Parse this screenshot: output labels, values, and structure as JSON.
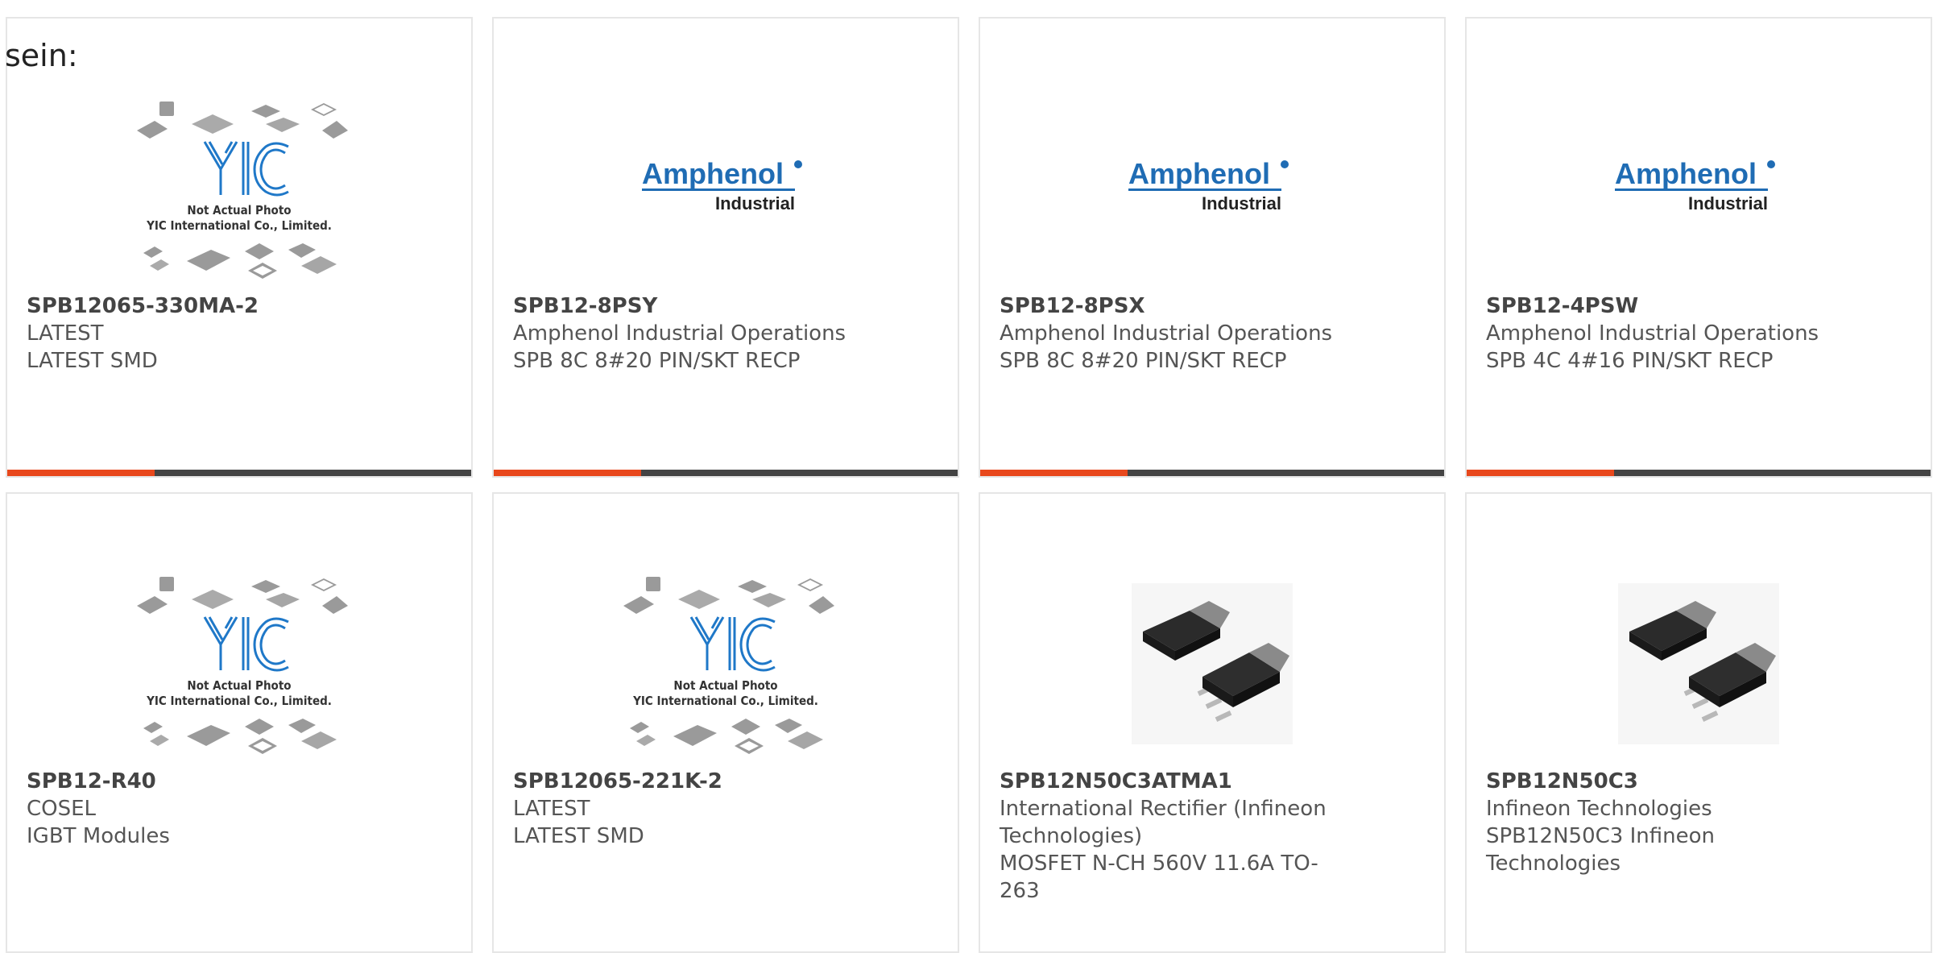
{
  "intro_text": "sein:",
  "products": [
    {
      "part": "SPB12065-330MA-2",
      "maker": "LATEST",
      "desc": "LATEST SMD",
      "image": "yic-placeholder-photo"
    },
    {
      "part": "SPB12-8PSY",
      "maker": "Amphenol Industrial Operations",
      "desc": "SPB 8C 8#20 PIN/SKT RECP",
      "image": "amphenol-industrial-logo"
    },
    {
      "part": "SPB12-8PSX",
      "maker": "Amphenol Industrial Operations",
      "desc": "SPB 8C 8#20 PIN/SKT RECP",
      "image": "amphenol-industrial-logo"
    },
    {
      "part": "SPB12-4PSW",
      "maker": "Amphenol Industrial Operations",
      "desc": "SPB 4C 4#16 PIN/SKT RECP",
      "image": "amphenol-industrial-logo"
    },
    {
      "part": "SPB12-R40",
      "maker": "COSEL",
      "desc": "IGBT Modules",
      "image": "yic-placeholder-photo"
    },
    {
      "part": "SPB12065-221K-2",
      "maker": "LATEST",
      "desc": "LATEST SMD",
      "image": "yic-placeholder-photo"
    },
    {
      "part": "SPB12N50C3ATMA1",
      "maker": "International Rectifier (Infineon Technologies)",
      "desc": "MOSFET N-CH 560V 11.6A TO-263",
      "image": "to263-package-photo"
    },
    {
      "part": "SPB12N50C3",
      "maker": "Infineon Technologies",
      "desc": "SPB12N50C3 Infineon Technologies",
      "image": "to263-package-photo"
    }
  ],
  "placeholder_photo": {
    "line1": "Not Actual Photo",
    "line2": "YIC International Co., Limited."
  },
  "logo": {
    "brand": "Amphenol",
    "sub": "Industrial"
  },
  "colors": {
    "accent": "#e8481c",
    "bar": "#444444",
    "card_border": "#e6e6e6",
    "amphenol_blue": "#1f6cb4"
  }
}
